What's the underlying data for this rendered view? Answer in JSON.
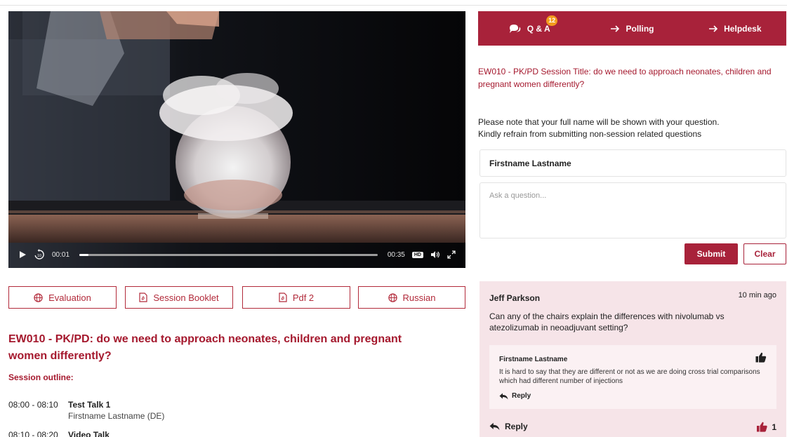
{
  "video": {
    "current_time": "00:01",
    "duration": "00:35",
    "progress_percent": 3,
    "hd_label": "HD",
    "colors": {
      "background": "#0b0b0d",
      "counter": "#6b4a3e"
    }
  },
  "resources": [
    {
      "label": "Evaluation",
      "icon": "globe-icon"
    },
    {
      "label": "Session Booklet",
      "icon": "pdf-icon"
    },
    {
      "label": "Pdf 2",
      "icon": "pdf-icon"
    },
    {
      "label": "Russian",
      "icon": "globe-icon"
    }
  ],
  "session": {
    "title": "EW010 - PK/PD: do we need to approach neonates, children and pregnant women differently?",
    "outline_label": "Session outline:",
    "agenda": [
      {
        "time": "08:00 - 08:10",
        "title": "Test Talk 1",
        "speaker": "Firstname Lastname (DE)"
      },
      {
        "time": "08:10 - 08:20",
        "title": "Video Talk",
        "speaker": ""
      }
    ]
  },
  "tabs": [
    {
      "label": "Q & A",
      "icon": "chat-bubbles-icon",
      "badge": "12"
    },
    {
      "label": "Polling",
      "icon": "arrow-right-icon"
    },
    {
      "label": "Helpdesk",
      "icon": "arrow-right-icon"
    }
  ],
  "qa": {
    "session_title": "EW010 - PK/PD Session Title: do we need to approach neonates, children and pregnant women differently?",
    "note_line1": "Please note that your full name will be shown with your question.",
    "note_line2": "Kindly refrain from submitting non-session related questions",
    "name_value": "Firstname Lastname",
    "question_placeholder": "Ask a question...",
    "submit_label": "Submit",
    "clear_label": "Clear"
  },
  "question": {
    "author": "Jeff Parkson",
    "time": "10 min ago",
    "text": "Can any of the chairs explain the differences with nivolumab vs atezolizumab in neoadjuvant setting?",
    "reply_label": "Reply",
    "likes": "1",
    "answer": {
      "author": "Firstname Lastname",
      "text": "It is hard to say that they are different or not as we are doing cross trial comparisons which had different number of injections",
      "reply_label": "Reply"
    }
  },
  "colors": {
    "brand": "#a8223a",
    "brand_text": "#a5192e",
    "card_bg": "#f6e4e8",
    "answer_bg": "#fbf1f3",
    "badge": "#f29b1d"
  }
}
